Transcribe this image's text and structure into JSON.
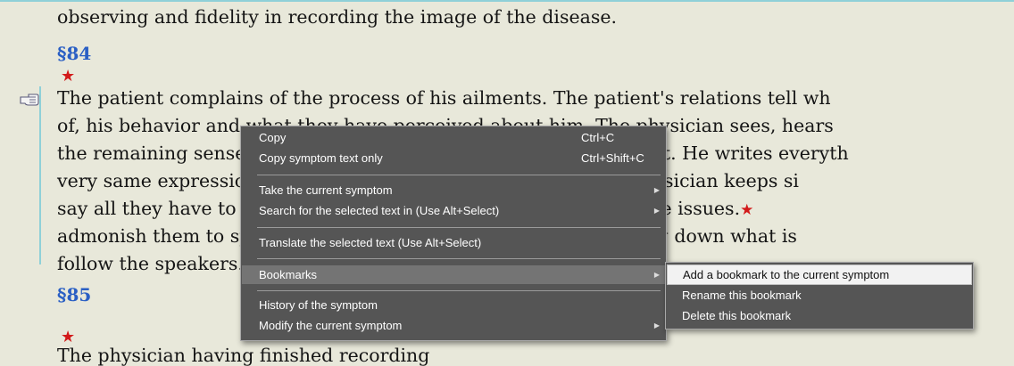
{
  "document": {
    "line_0": "observing and fidelity in recording the image of the disease.",
    "section_84": "§84",
    "lines_84": [
      "The patient complains of the process of his ailments. The patient's relations tell wh",
      "of, his behavior and what they have perceived about him. The physician sees, hears",
      "the remaining senses what is altered or unusual about the patient. He writes everyth",
      "very same expressions that the patient and his relations. The physician keeps si",
      "say all they have to say and interrupts only if they stray off to side issues.",
      "admonish them to speak slowly from the outset so that, in writing down what is",
      "follow the speakers."
    ],
    "section_85": "§85",
    "bottom_partial": "The physician having finished recording"
  },
  "context_menu": {
    "items": [
      {
        "label": "Copy",
        "shortcut": "Ctrl+C"
      },
      {
        "label": "Copy symptom text only",
        "shortcut": "Ctrl+Shift+C"
      },
      {
        "label": "Take the current symptom"
      },
      {
        "label": "Search for the selected text in (Use Alt+Select)"
      },
      {
        "label": "Translate the selected text (Use Alt+Select)"
      },
      {
        "label": "Bookmarks"
      },
      {
        "label": "History of the symptom"
      },
      {
        "label": "Modify the current symptom"
      }
    ]
  },
  "bookmarks_submenu": {
    "items": [
      {
        "label": "Add a bookmark to the current symptom"
      },
      {
        "label": "Rename this bookmark"
      },
      {
        "label": "Delete this bookmark"
      }
    ]
  },
  "colors": {
    "background": "#e8e8da",
    "section_heading": "#2a5fc4",
    "star": "#d21a1a",
    "menu_bg": "#555555"
  }
}
